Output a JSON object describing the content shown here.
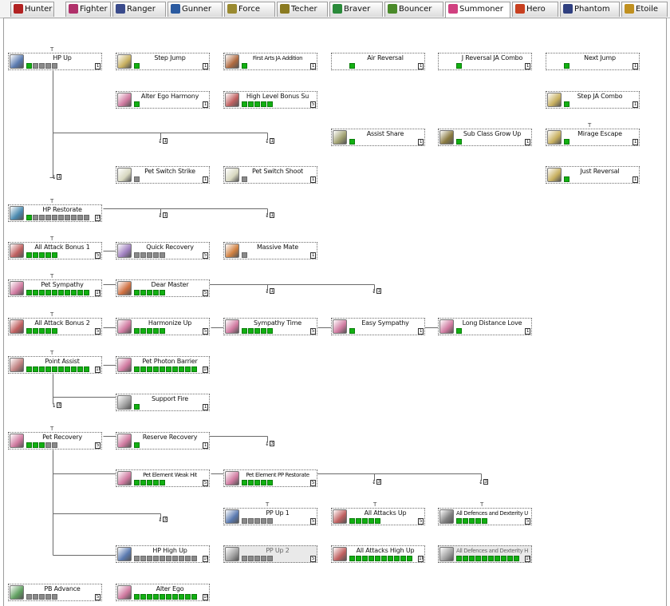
{
  "tabs": [
    {
      "label": "Hunter",
      "icon": "hunter-class-icon",
      "color": "#b22222",
      "active": false
    },
    {
      "label": "Fighter",
      "icon": "fighter-class-icon",
      "color": "#b0306a",
      "active": false
    },
    {
      "label": "Ranger",
      "icon": "ranger-class-icon",
      "color": "#3a4b8c",
      "active": false
    },
    {
      "label": "Gunner",
      "icon": "gunner-class-icon",
      "color": "#2a5aa0",
      "active": false
    },
    {
      "label": "Force",
      "icon": "force-class-icon",
      "color": "#9a8a30",
      "active": false
    },
    {
      "label": "Techer",
      "icon": "techer-class-icon",
      "color": "#8a7a20",
      "active": false
    },
    {
      "label": "Braver",
      "icon": "braver-class-icon",
      "color": "#2a8a3a",
      "active": false
    },
    {
      "label": "Bouncer",
      "icon": "bouncer-class-icon",
      "color": "#4a8a2a",
      "active": false
    },
    {
      "label": "Summoner",
      "icon": "summoner-class-icon",
      "color": "#d04080",
      "active": true
    },
    {
      "label": "Hero",
      "icon": "hero-class-icon",
      "color": "#c84020",
      "active": false
    },
    {
      "label": "Phantom",
      "icon": "phantom-class-icon",
      "color": "#304080",
      "active": false
    },
    {
      "label": "Etoile",
      "icon": "etoile-class-icon",
      "color": "#c09020",
      "active": false
    }
  ],
  "skills": [
    {
      "name": "HP Up",
      "icon": "hp-up-icon",
      "color": "#5a7ab0",
      "levels": 5,
      "filled": 1,
      "max": "1",
      "top_mark": "T"
    },
    {
      "name": "Step Jump",
      "icon": "step-jump-icon",
      "color": "#c8b060",
      "levels": 1,
      "filled": 1,
      "max": "1"
    },
    {
      "name": "First Arts JA Addition",
      "icon": "first-arts-ja-icon",
      "color": "#b06a40",
      "levels": 1,
      "filled": 1,
      "max": "1",
      "small": true
    },
    {
      "name": "Air Reversal",
      "icon": "",
      "color": "",
      "levels": 1,
      "filled": 1,
      "max": "1"
    },
    {
      "name": "J Reversal JA Combo",
      "icon": "",
      "color": "",
      "levels": 1,
      "filled": 1,
      "max": "1"
    },
    {
      "name": "Next Jump",
      "icon": "",
      "color": "",
      "levels": 1,
      "filled": 1,
      "max": "1"
    },
    {
      "name": "Alter Ego Harmony",
      "icon": "alter-ego-harmony-icon",
      "color": "#d07aa0",
      "levels": 1,
      "filled": 1,
      "max": "1"
    },
    {
      "name": "High Level Bonus Su",
      "icon": "high-level-bonus-icon",
      "color": "#c06060",
      "levels": 5,
      "filled": 5,
      "max": "5"
    },
    {
      "name": "Step JA Combo",
      "icon": "step-ja-combo-icon",
      "color": "#c8b060",
      "levels": 1,
      "filled": 1,
      "max": "1"
    },
    {
      "name": "Assist Share",
      "icon": "assist-share-icon",
      "color": "#a0a070",
      "levels": 1,
      "filled": 1,
      "max": "1"
    },
    {
      "name": "Sub Class Grow Up",
      "icon": "exp-icon",
      "color": "#8a7a40",
      "levels": 1,
      "filled": 1,
      "max": "1"
    },
    {
      "name": "Mirage Escape",
      "icon": "mirage-escape-icon",
      "color": "#c8b060",
      "levels": 1,
      "filled": 1,
      "max": "1",
      "top_mark": "T"
    },
    {
      "name": "Pet Switch Strike",
      "icon": "pet-switch-strike-icon",
      "color": "#d8d8c0",
      "levels": 1,
      "filled": 0,
      "max": "1"
    },
    {
      "name": "Pet Switch Shoot",
      "icon": "pet-switch-shoot-icon",
      "color": "#d8d8c0",
      "levels": 1,
      "filled": 0,
      "max": "1"
    },
    {
      "name": "Just Reversal",
      "icon": "just-reversal-icon",
      "color": "#c8b060",
      "levels": 1,
      "filled": 1,
      "max": "1"
    },
    {
      "name": "HP Restorate",
      "icon": "hp-restorate-icon",
      "color": "#4a8ab0",
      "levels": 10,
      "filled": 1,
      "max": "10",
      "top_mark": "T"
    },
    {
      "name": "All Attack Bonus 1",
      "icon": "all-attack-bonus-icon",
      "color": "#c06060",
      "levels": 5,
      "filled": 5,
      "max": "5",
      "top_mark": "T"
    },
    {
      "name": "Quick Recovery",
      "icon": "quick-recovery-icon",
      "color": "#a080c0",
      "levels": 5,
      "filled": 0,
      "max": "5"
    },
    {
      "name": "Massive Mate",
      "icon": "massive-mate-icon",
      "color": "#d08040",
      "levels": 1,
      "filled": 0,
      "max": "1"
    },
    {
      "name": "Pet Sympathy",
      "icon": "pet-sympathy-icon",
      "color": "#d07aa0",
      "levels": 10,
      "filled": 10,
      "max": "10",
      "top_mark": "T"
    },
    {
      "name": "Dear Master",
      "icon": "dear-master-icon",
      "color": "#d07040",
      "levels": 5,
      "filled": 5,
      "max": "5"
    },
    {
      "name": "All Attack Bonus 2",
      "icon": "all-attack-bonus-icon",
      "color": "#c06060",
      "levels": 5,
      "filled": 5,
      "max": "5",
      "top_mark": "T"
    },
    {
      "name": "Harmonize Up",
      "icon": "harmonize-up-icon",
      "color": "#d07aa0",
      "levels": 5,
      "filled": 5,
      "max": "5"
    },
    {
      "name": "Sympathy Time",
      "icon": "sympathy-time-icon",
      "color": "#d07aa0",
      "levels": 5,
      "filled": 5,
      "max": "5"
    },
    {
      "name": "Easy Sympathy",
      "icon": "easy-sympathy-icon",
      "color": "#d07aa0",
      "levels": 1,
      "filled": 1,
      "max": "1"
    },
    {
      "name": "Long Distance Love",
      "icon": "long-distance-love-icon",
      "color": "#d07aa0",
      "levels": 1,
      "filled": 1,
      "max": "1"
    },
    {
      "name": "Point Assist",
      "icon": "point-assist-icon",
      "color": "#c08080",
      "levels": 10,
      "filled": 10,
      "max": "10",
      "top_mark": "T"
    },
    {
      "name": "Pet Photon Barrier",
      "icon": "pet-photon-barrier-icon",
      "color": "#d07aa0",
      "levels": 10,
      "filled": 10,
      "max": "10"
    },
    {
      "name": "Support Fire",
      "icon": "support-fire-icon",
      "color": "#a0a0a0",
      "levels": 1,
      "filled": 1,
      "max": "1"
    },
    {
      "name": "Pet Recovery",
      "icon": "pet-recovery-icon",
      "color": "#d07aa0",
      "levels": 5,
      "filled": 3,
      "max": "5",
      "top_mark": "T"
    },
    {
      "name": "Reserve Recovery",
      "icon": "reserve-recovery-icon",
      "color": "#d07aa0",
      "levels": 1,
      "filled": 1,
      "max": "1"
    },
    {
      "name": "Pet Element Weak Hit",
      "icon": "pet-element-weak-hit-icon",
      "color": "#d07aa0",
      "levels": 5,
      "filled": 5,
      "max": "5",
      "small": true
    },
    {
      "name": "Pet Element PP Restorate",
      "icon": "pet-element-pp-restorate-icon",
      "color": "#d07aa0",
      "levels": 5,
      "filled": 5,
      "max": "5",
      "small": true
    },
    {
      "name": "PP Up 1",
      "icon": "pp-up-icon",
      "color": "#5a7ab0",
      "levels": 5,
      "filled": 0,
      "max": "5",
      "top_mark": "T"
    },
    {
      "name": "All Attacks Up",
      "icon": "all-attacks-up-icon",
      "color": "#c06060",
      "levels": 5,
      "filled": 5,
      "max": "5",
      "top_mark": "T"
    },
    {
      "name": "All Defences and Dexterity Up",
      "icon": "defences-dexterity-up-icon",
      "color": "#808080",
      "levels": 5,
      "filled": 5,
      "max": "5",
      "top_mark": "T",
      "small": true
    },
    {
      "name": "HP High Up",
      "icon": "hp-high-up-icon",
      "color": "#5a7ab0",
      "levels": 10,
      "filled": 0,
      "max": "10"
    },
    {
      "name": "PP Up 2",
      "icon": "pp-up-2-icon",
      "color": "#a0a0a0",
      "levels": 5,
      "filled": 0,
      "max": "5",
      "dim": true
    },
    {
      "name": "All Attacks High Up",
      "icon": "all-attacks-high-up-icon",
      "color": "#c06060",
      "levels": 10,
      "filled": 10,
      "max": "10"
    },
    {
      "name": "All Defences and Dexterity High Up",
      "icon": "defences-dexterity-high-up-icon",
      "color": "#a0a0a0",
      "levels": 10,
      "filled": 10,
      "max": "10",
      "dim": true,
      "small": true
    },
    {
      "name": "PB Advance",
      "icon": "pb-advance-icon",
      "color": "#60a060",
      "levels": 5,
      "filled": 0,
      "max": "5"
    },
    {
      "name": "Alter Ego",
      "icon": "alter-ego-icon",
      "color": "#d07aa0",
      "levels": 10,
      "filled": 10,
      "max": "10"
    }
  ],
  "markers": [
    {
      "value": "1"
    },
    {
      "value": "1"
    },
    {
      "value": "1"
    },
    {
      "value": "1"
    },
    {
      "value": "1"
    },
    {
      "value": "1"
    },
    {
      "value": "1"
    },
    {
      "value": "3"
    },
    {
      "value": "3"
    },
    {
      "value": "3"
    },
    {
      "value": "3"
    },
    {
      "value": "3"
    }
  ]
}
